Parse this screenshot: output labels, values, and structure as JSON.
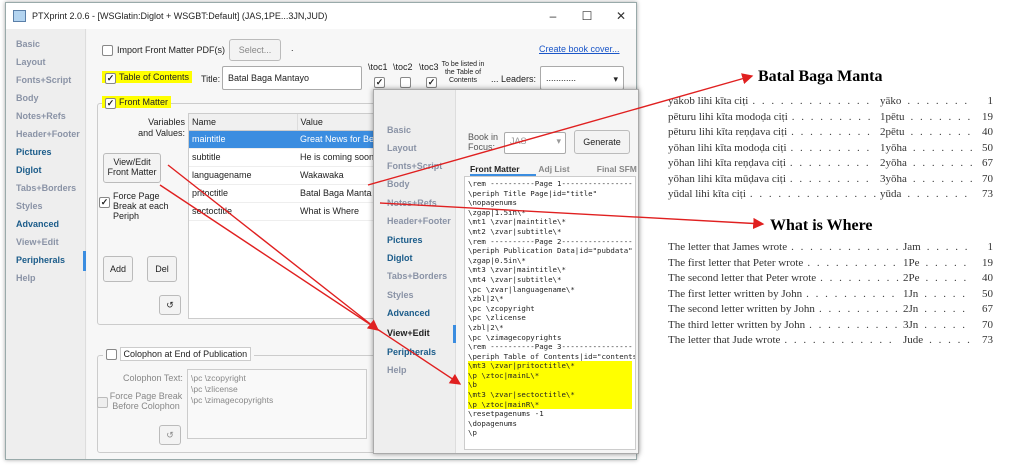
{
  "window": {
    "title": "PTXprint 2.0.6 -  [WSGlatin:Diglot + WSGBT:Default]  (JAS,1PE...3JN,JUD)",
    "min_glyph": "–",
    "max_glyph": "☐",
    "close_glyph": "✕"
  },
  "sidebar": {
    "items": [
      "Basic",
      "Layout",
      "Fonts+Script",
      "Body",
      "Notes+Refs",
      "Header+Footer",
      "Pictures",
      "Diglot",
      "Tabs+Borders",
      "Styles",
      "Advanced",
      "View+Edit",
      "Peripherals",
      "Help"
    ]
  },
  "frontmatter": {
    "import_label": "Import Front Matter PDF(s)",
    "select_label": "Select...",
    "dot": ".",
    "create_cover_link": "Create book cover...",
    "toc_label": "Table of Contents",
    "title_label": "Title:",
    "title_value": "Batal Baga Mantayo",
    "toc1_label": "\\toc1",
    "toc2_label": "\\toc2",
    "toc3_label": "\\toc3",
    "toc_note": "To be listed in the Table of Contents",
    "leaders_label": "... Leaders:",
    "leaders_value": "............",
    "fm_label": "Front Matter",
    "vars_label": "Variables and Values:",
    "view_edit_button": "View/Edit Front Matter",
    "force_break_label": "Force Page Break at each Periph",
    "add_button": "Add",
    "del_button": "Del",
    "refresh_glyph": "↺",
    "table_headers": [
      "Name",
      "Value"
    ],
    "rows": [
      {
        "name": "maintitle",
        "value": "Great News for Belie"
      },
      {
        "name": "subtitle",
        "value": "He is coming soon!"
      },
      {
        "name": "languagename",
        "value": "Wakawaka"
      },
      {
        "name": "pritoctitle",
        "value": "Batal Baga Manta"
      },
      {
        "name": "sectoctitle",
        "value": "What is Where"
      }
    ]
  },
  "colophon": {
    "label": "Colophon at End of Publication",
    "text_label": "Colophon Text:",
    "text_lines": [
      "\\pc \\zcopyright",
      "\\pc \\zlicense",
      "\\pc \\zimagecopyrights"
    ],
    "force_label": "Force Page Break Before Colophon"
  },
  "second_window": {
    "sidebar": [
      "Basic",
      "Layout",
      "Fonts+Script",
      "Body",
      "Notes+Refs",
      "Header+Footer",
      "Pictures",
      "Diglot",
      "Tabs+Borders",
      "Styles",
      "Advanced",
      "View+Edit",
      "Peripherals",
      "Help"
    ],
    "book_label": "Book in Focus:",
    "book_value": "JAS",
    "generate_button": "Generate",
    "tabs": [
      "Front Matter",
      "Adj List",
      "Final SFM"
    ],
    "code_lines": [
      "\\rem ----------Page 1----------------",
      "\\periph Title Page|id=\"title\"",
      "\\nopagenums",
      "\\zgap|1.5in\\*",
      "\\mt1 \\zvar|maintitle\\*",
      "\\mt2 \\zvar|subtitle\\*",
      "\\rem ----------Page 2----------------",
      "\\periph Publication Data|id=\"pubdata\"",
      "\\zgap|0.5in\\*",
      "\\mt3 \\zvar|maintitle\\*",
      "\\mt4 \\zvar|subtitle\\*",
      "\\pc \\zvar|languagename\\*",
      "\\zbl|2\\*",
      "\\pc \\zcopyright",
      "\\pc \\zlicense",
      "\\zbl|2\\*",
      "\\pc \\zimagecopyrights",
      "\\rem ----------Page 3----------------",
      "\\periph Table of Contents|id=\"contents\"",
      "\\mt3 \\zvar|pritoctitle\\*",
      "\\p \\ztoc|mainL\\*",
      "\\b",
      "\\mt3 \\zvar|sectoctitle\\*",
      "\\p \\ztoc|mainR\\*",
      "\\resetpagenums -1",
      "\\dopagenums",
      "\\p"
    ]
  },
  "preview": {
    "title1": "Batal Baga Manta",
    "toc1": [
      {
        "t": "yākob lihi kīta ciṭi",
        "a": "yāko",
        "p": "1"
      },
      {
        "t": "pēturu lihi kīta modoḍa ciṭi",
        "a": "1pētu",
        "p": "19"
      },
      {
        "t": "pēturu lihi kīta reṇḍava ciṭi",
        "a": "2pētu",
        "p": "40"
      },
      {
        "t": "yōhan lihi kīta modoḍa ciṭi",
        "a": "1yōha",
        "p": "50"
      },
      {
        "t": "yōhan lihi kīta reṇḍava ciṭi",
        "a": "2yōha",
        "p": "67"
      },
      {
        "t": "yōhan lihi kīta mūḍava ciṭi",
        "a": "3yōha",
        "p": "70"
      },
      {
        "t": "yūdal lihi kīta ciṭi",
        "a": "yūda",
        "p": "73"
      }
    ],
    "title2": "What is Where",
    "toc2": [
      {
        "t": "The letter that James wrote",
        "a": "Jam",
        "p": "1"
      },
      {
        "t": "The first letter that Peter wrote",
        "a": "1Pe",
        "p": "19"
      },
      {
        "t": "The second letter that Peter wrote",
        "a": "2Pe",
        "p": "40"
      },
      {
        "t": "The first letter written by John",
        "a": "1Jn",
        "p": "50"
      },
      {
        "t": "The second letter written by John",
        "a": "2Jn",
        "p": "67"
      },
      {
        "t": "The third letter written by John",
        "a": "3Jn",
        "p": "70"
      },
      {
        "t": "The letter that Jude wrote",
        "a": "Jude",
        "p": "73"
      }
    ]
  },
  "colors": {
    "highlight": "#ffff00",
    "accent": "#3b8de0",
    "arrow": "#e02020"
  }
}
